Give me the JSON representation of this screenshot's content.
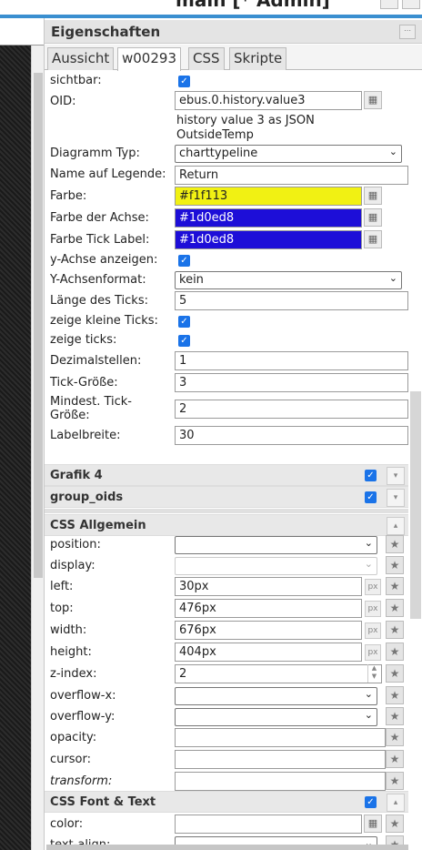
{
  "window": {
    "title": "main [* Admin]"
  },
  "panel": {
    "title": "Eigenschaften",
    "menu_icon": "menu-dots-icon",
    "tabs": [
      {
        "label": "Aussicht",
        "active": false
      },
      {
        "label": "w00293",
        "active": true
      },
      {
        "label": "CSS",
        "active": false
      },
      {
        "label": "Skripte",
        "active": false
      }
    ]
  },
  "fields": {
    "visible": {
      "label": "sichtbar:",
      "checked": true
    },
    "oid": {
      "label": "OID:",
      "value": "ebus.0.history.value3",
      "desc_line1": "history value 3 as JSON",
      "desc_line2": "OutsideTemp"
    },
    "chart_type": {
      "label": "Diagramm Typ:",
      "value": "charttypeline"
    },
    "legend_name": {
      "label": "Name auf Legende:",
      "value": "Return"
    },
    "color": {
      "label": "Farbe:",
      "value": "#f1f113"
    },
    "axis_color": {
      "label": "Farbe der Achse:",
      "value": "#1d0ed8"
    },
    "tick_label_color": {
      "label": "Farbe Tick Label:",
      "value": "#1d0ed8"
    },
    "show_y_axis": {
      "label": "y-Achse anzeigen:",
      "checked": true
    },
    "y_axis_format": {
      "label": "Y-Achsenformat:",
      "value": "kein"
    },
    "tick_length": {
      "label": "Länge des Ticks:",
      "value": "5"
    },
    "show_small_ticks": {
      "label": "zeige kleine Ticks:",
      "checked": true
    },
    "show_ticks": {
      "label": "zeige ticks:",
      "checked": true
    },
    "decimals": {
      "label": "Dezimalstellen:",
      "value": "1"
    },
    "tick_size": {
      "label": "Tick-Größe:",
      "value": "3"
    },
    "min_tick_size": {
      "label_line1": "Mindest. Tick-",
      "label_line2": "Größe:",
      "value": "2"
    },
    "label_width": {
      "label": "Labelbreite:",
      "value": "30"
    }
  },
  "groups": {
    "grafik4": {
      "label": "Grafik 4",
      "checked": true
    },
    "group_oids": {
      "label": "group_oids",
      "checked": true
    },
    "css_general": {
      "label": "CSS Allgemein"
    },
    "css_font": {
      "label": "CSS Font & Text",
      "checked": true
    }
  },
  "css": {
    "position": {
      "label": "position:",
      "value": ""
    },
    "display": {
      "label": "display:",
      "value": ""
    },
    "left": {
      "label": "left:",
      "value": "30px",
      "unit": "px"
    },
    "top": {
      "label": "top:",
      "value": "476px",
      "unit": "px"
    },
    "width": {
      "label": "width:",
      "value": "676px",
      "unit": "px"
    },
    "height": {
      "label": "height:",
      "value": "404px",
      "unit": "px"
    },
    "z_index": {
      "label": "z-index:",
      "value": "2"
    },
    "overflow_x": {
      "label": "overflow-x:",
      "value": ""
    },
    "overflow_y": {
      "label": "overflow-y:",
      "value": ""
    },
    "opacity": {
      "label": "opacity:",
      "value": ""
    },
    "cursor": {
      "label": "cursor:",
      "value": ""
    },
    "transform": {
      "label": "transform:",
      "value": ""
    },
    "color": {
      "label": "color:",
      "value": ""
    },
    "text_align": {
      "label": "text-align:",
      "value": ""
    }
  },
  "colors": {
    "accent": "#3a8fd0",
    "checkbox": "#1a73e8",
    "color_value": "#f1f113",
    "axis_value": "#1d0ed8"
  }
}
